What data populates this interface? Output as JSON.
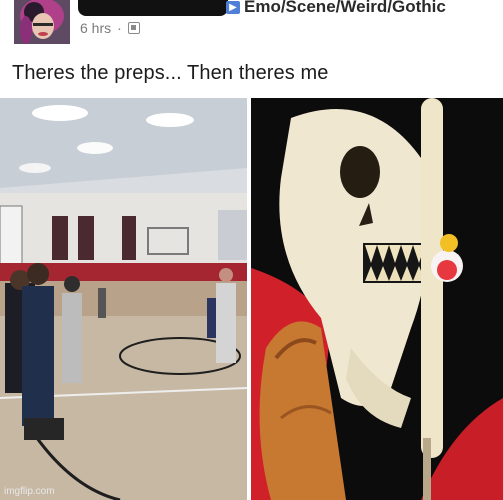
{
  "post": {
    "group_name": "Emo/Scene/Weird/Gothic",
    "time": "6 hrs",
    "separator": "·",
    "caption": "Theres the preps... Then theres me",
    "group_arrow": "▶",
    "icons": {
      "avatar": "profile-photo",
      "audience": "group-audience-icon",
      "group_arrow": "arrow-right-icon"
    }
  },
  "watermark": "imgflip.com",
  "colors": {
    "accent": "#4f7fd6",
    "caption": "#1c1c1c",
    "meta": "#7b7b7b"
  }
}
